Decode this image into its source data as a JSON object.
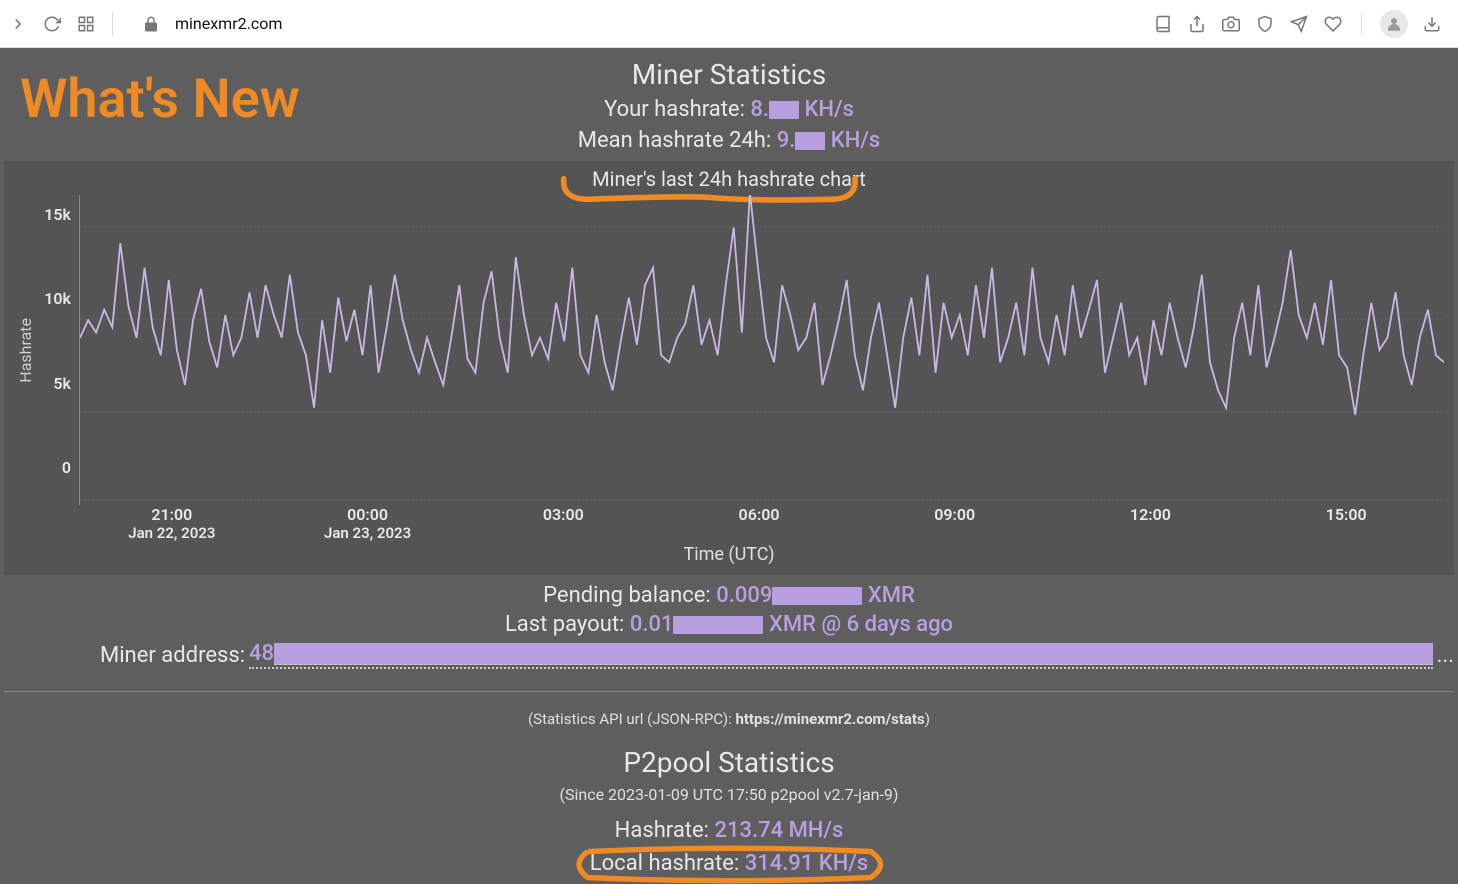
{
  "browser": {
    "url": "minexmr2.com"
  },
  "header": {
    "whats_new": "What's New",
    "title": "Miner Statistics",
    "your_hashrate_label": "Your hashrate:",
    "your_hashrate_prefix": "8.",
    "your_hashrate_unit": " KH/s",
    "mean_hashrate_label": "Mean hashrate 24h:",
    "mean_hashrate_prefix": "9.",
    "mean_hashrate_unit": " KH/s",
    "chart_subtitle": "Miner's last 24h hashrate chart"
  },
  "chart_data": {
    "type": "line",
    "title": "Miner's last 24h hashrate chart",
    "xlabel": "Time (UTC)",
    "ylabel": "Hashrate",
    "ylim": [
      0,
      17000
    ],
    "y_ticks": [
      "15k",
      "10k",
      "5k",
      "0"
    ],
    "x_ticks": [
      {
        "time": "21:00",
        "date": "Jan 22, 2023"
      },
      {
        "time": "00:00",
        "date": "Jan 23, 2023"
      },
      {
        "time": "03:00",
        "date": ""
      },
      {
        "time": "06:00",
        "date": ""
      },
      {
        "time": "09:00",
        "date": ""
      },
      {
        "time": "12:00",
        "date": ""
      },
      {
        "time": "15:00",
        "date": ""
      }
    ],
    "values": [
      9200,
      10200,
      9500,
      10800,
      9800,
      14600,
      11000,
      9200,
      13200,
      9800,
      8200,
      12500,
      8500,
      6500,
      10200,
      12000,
      9000,
      7500,
      10500,
      8200,
      9200,
      11800,
      9200,
      12200,
      10500,
      9200,
      12800,
      9500,
      8200,
      5200,
      10200,
      7200,
      11500,
      9000,
      10800,
      8200,
      12200,
      7200,
      9800,
      12800,
      10200,
      8500,
      7200,
      9200,
      7800,
      6500,
      9200,
      12200,
      8000,
      7200,
      11200,
      13000,
      9200,
      7200,
      13800,
      10500,
      8200,
      9200,
      8000,
      11200,
      9000,
      13200,
      8200,
      7200,
      10500,
      7800,
      6200,
      9000,
      11500,
      8800,
      12200,
      13200,
      8200,
      7800,
      9200,
      10000,
      12200,
      8800,
      10200,
      8200,
      12200,
      15500,
      9500,
      17500,
      13200,
      9200,
      7800,
      12200,
      10500,
      8500,
      9200,
      11200,
      6500,
      8200,
      10200,
      12500,
      8200,
      6200,
      9200,
      11200,
      8200,
      5200,
      9200,
      11500,
      8200,
      12800,
      7200,
      11200,
      9200,
      10500,
      8200,
      12200,
      9200,
      13200,
      7800,
      9200,
      11200,
      8200,
      13200,
      9200,
      7800,
      10500,
      8200,
      12200,
      9200,
      10800,
      12500,
      7200,
      9200,
      11200,
      8200,
      9200,
      6500,
      10200,
      8200,
      11200,
      9200,
      7500,
      9800,
      12800,
      7800,
      6200,
      5200,
      9200,
      11200,
      8200,
      12200,
      7500,
      9200,
      11200,
      14200,
      10500,
      9200,
      11200,
      8800,
      12500,
      8200,
      7500,
      4800,
      8200,
      11200,
      8500,
      9200,
      11800,
      8200,
      6500,
      9200,
      10800,
      8200,
      7800
    ]
  },
  "balance": {
    "pending_label": "Pending balance:",
    "pending_prefix": "0.009",
    "pending_unit": " XMR",
    "payout_label": "Last payout:",
    "payout_prefix": "0.01",
    "payout_suffix": " XMR @ 6 days ago",
    "address_label": "Miner address:",
    "address_prefix": "48"
  },
  "api": {
    "prefix": "(Statistics API url (JSON-RPC): ",
    "url": "https://minexmr2.com/stats",
    "suffix": ")"
  },
  "p2pool": {
    "title": "P2pool Statistics",
    "since": "(Since 2023-01-09 UTC 17:50 p2pool v2.7-jan-9)",
    "hashrate_label": "Hashrate:",
    "hashrate_value": "213.74 MH/s",
    "local_label": "Local hashrate:",
    "local_value": "314.91 KH/s"
  }
}
